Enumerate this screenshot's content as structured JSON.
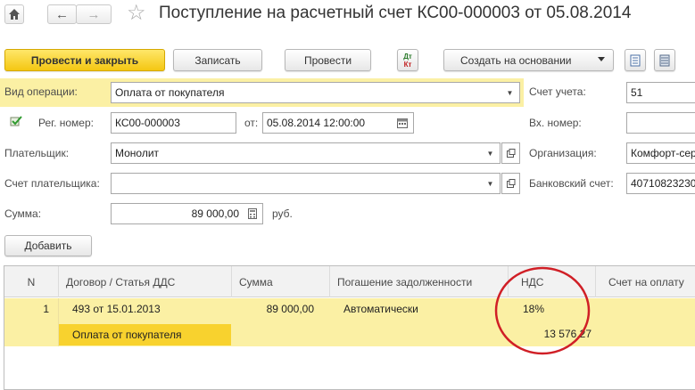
{
  "window": {
    "title": "Поступление на расчетный счет КС00-000003 от 05.08.2014"
  },
  "toolbar": {
    "post_close_label": "Провести и закрыть",
    "save_label": "Записать",
    "post_label": "Провести",
    "dtkt_top": "Дт",
    "dtkt_bottom": "Кт",
    "create_based_label": "Создать на основании"
  },
  "form": {
    "operation_type_label": "Вид операции:",
    "operation_type_value": "Оплата от покупателя",
    "reg_number_label": "Рег. номер:",
    "reg_number_value": "КС00-000003",
    "from_label": "от:",
    "date_value": "05.08.2014 12:00:00",
    "payer_label": "Плательщик:",
    "payer_value": "Монолит",
    "payer_account_label": "Счет плательщика:",
    "payer_account_value": "",
    "sum_label": "Сумма:",
    "sum_value": "89 000,00",
    "currency": "руб.",
    "account_label": "Счет учета:",
    "account_value": "51",
    "in_number_label": "Вх. номер:",
    "in_number_value": "",
    "org_label": "Организация:",
    "org_value": "Комфорт-сер",
    "bank_account_label": "Банковский счет:",
    "bank_account_value": "40710823230"
  },
  "table": {
    "add_label": "Добавить",
    "columns": [
      "N",
      "Договор / Статья ДДС",
      "Сумма",
      "Погашение задолженности",
      "НДС",
      "Счет на оплату"
    ],
    "rows": [
      {
        "n": "1",
        "contract": "493 от 15.01.2013",
        "cash_item": "Оплата от покупателя",
        "sum": "89 000,00",
        "repayment": "Автоматически",
        "vat_rate": "18%",
        "vat_amount": "13 576,27"
      }
    ]
  },
  "colors": {
    "accent": "#f4c712",
    "row_highlight": "#fbf0a4",
    "cell_selected": "#f8d22e",
    "annotation": "#d01f26"
  }
}
